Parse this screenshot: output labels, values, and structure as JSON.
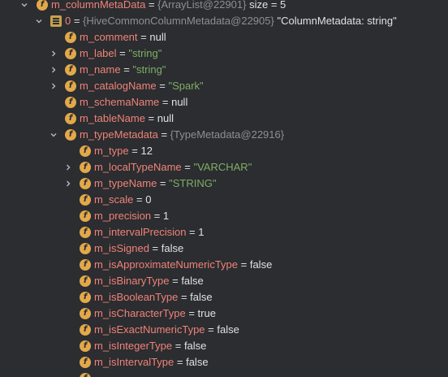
{
  "colors": {
    "background": "#2b2d30",
    "field_name": "#f08279",
    "string_value": "#7fae66",
    "object_ref": "#8c8f94",
    "plain_value": "#dfe1e5",
    "field_icon": "#e3a84a"
  },
  "tree": {
    "rows": [
      {
        "name": "m_columnMetaData",
        "eq": " = ",
        "ref": "{ArrayList@22901}",
        "value": "  size = 5",
        "value_type": "plain",
        "icon": "field-icon",
        "arrow": "expanded"
      },
      {
        "name": "0",
        "eq": " = ",
        "ref": "{HiveCommonColumnMetadata@22905}",
        "value": " \"ColumnMetadata: string\"",
        "value_type": "plain",
        "icon": "array-element-icon",
        "arrow": "expanded"
      },
      {
        "name": "m_comment",
        "eq": " = ",
        "ref": "",
        "value": "null",
        "value_type": "plain",
        "icon": "field-icon",
        "arrow": "none"
      },
      {
        "name": "m_label",
        "eq": " = ",
        "ref": "",
        "value": "\"string\"",
        "value_type": "string",
        "icon": "field-icon",
        "arrow": "collapsed"
      },
      {
        "name": "m_name",
        "eq": " = ",
        "ref": "",
        "value": "\"string\"",
        "value_type": "string",
        "icon": "field-icon",
        "arrow": "collapsed"
      },
      {
        "name": "m_catalogName",
        "eq": " = ",
        "ref": "",
        "value": "\"Spark\"",
        "value_type": "string",
        "icon": "field-icon",
        "arrow": "collapsed"
      },
      {
        "name": "m_schemaName",
        "eq": " = ",
        "ref": "",
        "value": "null",
        "value_type": "plain",
        "icon": "field-icon",
        "arrow": "none"
      },
      {
        "name": "m_tableName",
        "eq": " = ",
        "ref": "",
        "value": "null",
        "value_type": "plain",
        "icon": "field-icon",
        "arrow": "none"
      },
      {
        "name": "m_typeMetadata",
        "eq": " = ",
        "ref": "{TypeMetadata@22916}",
        "value": "",
        "value_type": "plain",
        "icon": "field-icon",
        "arrow": "expanded"
      },
      {
        "name": "m_type",
        "eq": " = ",
        "ref": "",
        "value": "12",
        "value_type": "plain",
        "icon": "field-icon",
        "arrow": "none"
      },
      {
        "name": "m_localTypeName",
        "eq": " = ",
        "ref": "",
        "value": "\"VARCHAR\"",
        "value_type": "string",
        "icon": "field-icon",
        "arrow": "collapsed"
      },
      {
        "name": "m_typeName",
        "eq": " = ",
        "ref": "",
        "value": "\"STRING\"",
        "value_type": "string",
        "icon": "field-icon",
        "arrow": "collapsed"
      },
      {
        "name": "m_scale",
        "eq": " = ",
        "ref": "",
        "value": "0",
        "value_type": "plain",
        "icon": "field-icon",
        "arrow": "none"
      },
      {
        "name": "m_precision",
        "eq": " = ",
        "ref": "",
        "value": "1",
        "value_type": "plain",
        "icon": "field-icon",
        "arrow": "none"
      },
      {
        "name": "m_intervalPrecision",
        "eq": " = ",
        "ref": "",
        "value": "1",
        "value_type": "plain",
        "icon": "field-icon",
        "arrow": "none"
      },
      {
        "name": "m_isSigned",
        "eq": " = ",
        "ref": "",
        "value": "false",
        "value_type": "plain",
        "icon": "field-icon",
        "arrow": "none"
      },
      {
        "name": "m_isApproximateNumericType",
        "eq": " = ",
        "ref": "",
        "value": "false",
        "value_type": "plain",
        "icon": "field-icon",
        "arrow": "none"
      },
      {
        "name": "m_isBinaryType",
        "eq": " = ",
        "ref": "",
        "value": "false",
        "value_type": "plain",
        "icon": "field-icon",
        "arrow": "none"
      },
      {
        "name": "m_isBooleanType",
        "eq": " = ",
        "ref": "",
        "value": "false",
        "value_type": "plain",
        "icon": "field-icon",
        "arrow": "none"
      },
      {
        "name": "m_isCharacterType",
        "eq": " = ",
        "ref": "",
        "value": "true",
        "value_type": "plain",
        "icon": "field-icon",
        "arrow": "none"
      },
      {
        "name": "m_isExactNumericType",
        "eq": " = ",
        "ref": "",
        "value": "false",
        "value_type": "plain",
        "icon": "field-icon",
        "arrow": "none"
      },
      {
        "name": "m_isIntegerType",
        "eq": " = ",
        "ref": "",
        "value": "false",
        "value_type": "plain",
        "icon": "field-icon",
        "arrow": "none"
      },
      {
        "name": "m_isIntervalType",
        "eq": " = ",
        "ref": "",
        "value": "false",
        "value_type": "plain",
        "icon": "field-icon",
        "arrow": "none"
      }
    ]
  }
}
